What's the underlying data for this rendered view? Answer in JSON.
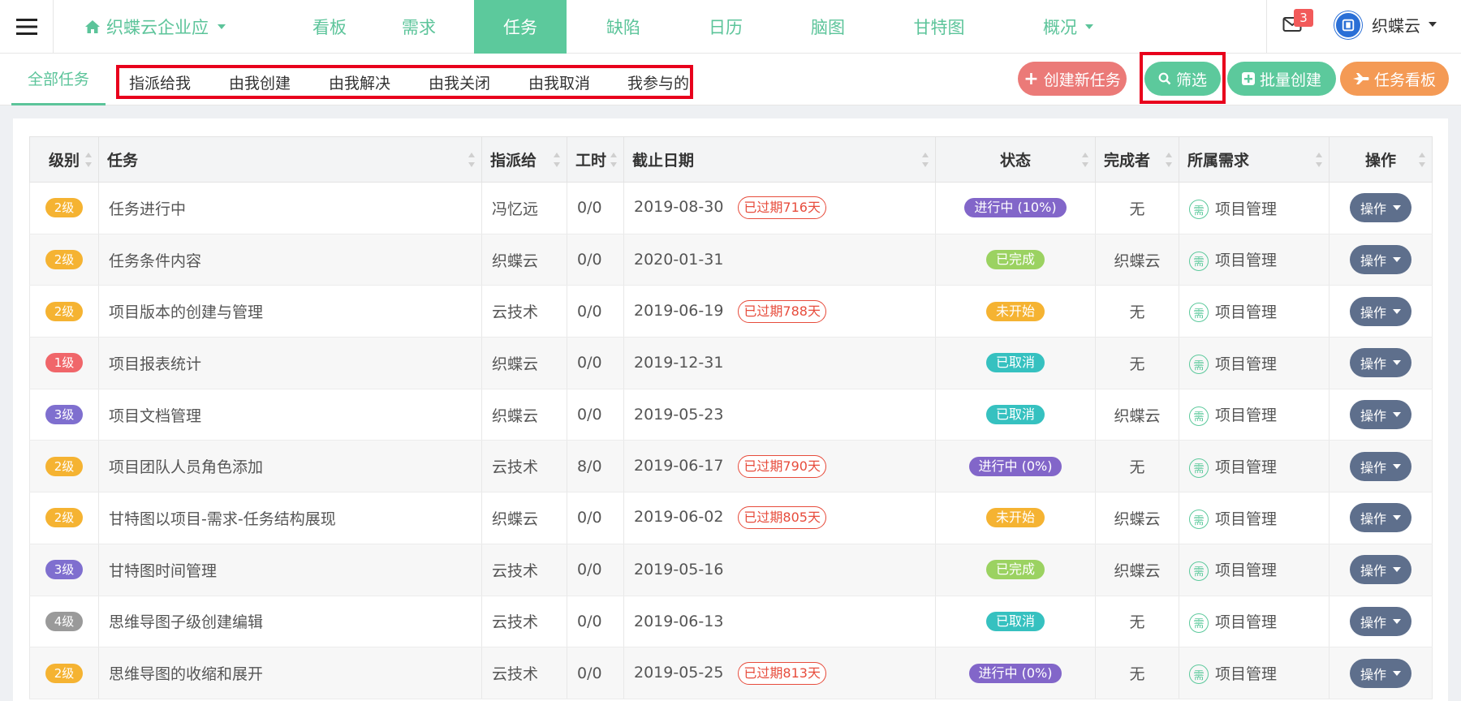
{
  "nav": {
    "app_title": "织蝶云企业应",
    "tabs": [
      "看板",
      "需求",
      "任务",
      "缺陷",
      "日历",
      "脑图",
      "甘特图",
      "概况"
    ],
    "active_tab": "任务",
    "mail_count": "3",
    "user_name": "织蝶云"
  },
  "subnav": {
    "all_tasks": "全部任务",
    "filters": [
      "指派给我",
      "由我创建",
      "由我解决",
      "由我关闭",
      "由我取消",
      "我参与的"
    ]
  },
  "actions": {
    "create": "创建新任务",
    "filter": "筛选",
    "batch": "批量创建",
    "board": "任务看板"
  },
  "table": {
    "headers": [
      "级别",
      "任务",
      "指派给",
      "工时",
      "截止日期",
      "状态",
      "完成者",
      "所属需求",
      "操作"
    ],
    "op_label": "操作",
    "req_icon_label": "需",
    "rows": [
      {
        "level": "2级",
        "task": "任务进行中",
        "assignee": "冯忆远",
        "hours": "0/0",
        "due": "2019-08-30",
        "overdue": "已过期716天",
        "status": "进行中 (10%)",
        "finisher": "无",
        "req": "项目管理"
      },
      {
        "level": "2级",
        "task": "任务条件内容",
        "assignee": "织蝶云",
        "hours": "0/0",
        "due": "2020-01-31",
        "overdue": "",
        "status": "已完成",
        "finisher": "织蝶云",
        "req": "项目管理"
      },
      {
        "level": "2级",
        "task": "项目版本的创建与管理",
        "assignee": "云技术",
        "hours": "0/0",
        "due": "2019-06-19",
        "overdue": "已过期788天",
        "status": "未开始",
        "finisher": "无",
        "req": "项目管理"
      },
      {
        "level": "1级",
        "task": "项目报表统计",
        "assignee": "织蝶云",
        "hours": "0/0",
        "due": "2019-12-31",
        "overdue": "",
        "status": "已取消",
        "finisher": "无",
        "req": "项目管理"
      },
      {
        "level": "3级",
        "task": "项目文档管理",
        "assignee": "织蝶云",
        "hours": "0/0",
        "due": "2019-05-23",
        "overdue": "",
        "status": "已取消",
        "finisher": "织蝶云",
        "req": "项目管理"
      },
      {
        "level": "2级",
        "task": "项目团队人员角色添加",
        "assignee": "云技术",
        "hours": "8/0",
        "due": "2019-06-17",
        "overdue": "已过期790天",
        "status": "进行中 (0%)",
        "finisher": "无",
        "req": "项目管理"
      },
      {
        "level": "2级",
        "task": "甘特图以项目-需求-任务结构展现",
        "assignee": "织蝶云",
        "hours": "0/0",
        "due": "2019-06-02",
        "overdue": "已过期805天",
        "status": "未开始",
        "finisher": "织蝶云",
        "req": "项目管理"
      },
      {
        "level": "3级",
        "task": "甘特图时间管理",
        "assignee": "云技术",
        "hours": "0/0",
        "due": "2019-05-16",
        "overdue": "",
        "status": "已完成",
        "finisher": "织蝶云",
        "req": "项目管理"
      },
      {
        "level": "4级",
        "task": "思维导图子级创建编辑",
        "assignee": "云技术",
        "hours": "0/0",
        "due": "2019-06-13",
        "overdue": "",
        "status": "已取消",
        "finisher": "无",
        "req": "项目管理"
      },
      {
        "level": "2级",
        "task": "思维导图的收缩和展开",
        "assignee": "云技术",
        "hours": "0/0",
        "due": "2019-05-25",
        "overdue": "已过期813天",
        "status": "进行中 (0%)",
        "finisher": "无",
        "req": "项目管理"
      }
    ]
  },
  "colors": {
    "accent": "#5cc99c",
    "level": {
      "1级": "#f0666a",
      "2级": "#f5b332",
      "3级": "#7f6fcf",
      "4级": "#9a9a9a"
    },
    "status": {
      "进行中": "#8266c9",
      "已完成": "#9bd261",
      "未开始": "#f5b332",
      "已取消": "#36c1c0"
    }
  }
}
